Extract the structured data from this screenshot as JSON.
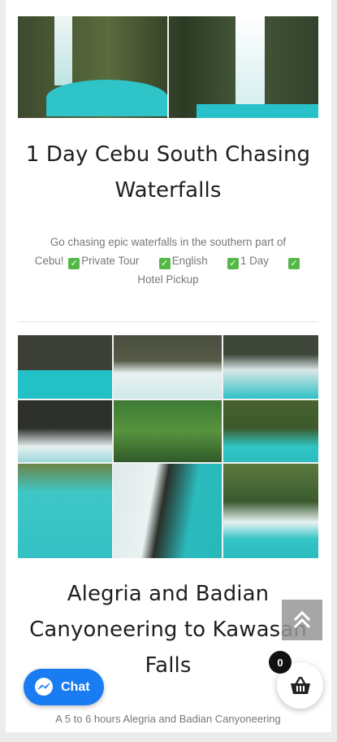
{
  "tours": [
    {
      "title_line1": "1 Day Cebu South Chasing",
      "title_line2": "Waterfalls",
      "desc_line1": "Go chasing epic waterfalls in the southern part of",
      "desc_cebu": "Cebu!",
      "features": [
        "Private Tour",
        "English",
        "1 Day",
        "Hotel Pickup"
      ]
    },
    {
      "title_line1": "Alegria and Badian",
      "title_line2": "Canyoneering to Kawasan",
      "title_line3": "Falls",
      "desc_line1": "A 5 to 6 hours Alegria and Badian Canyoneering"
    }
  ],
  "chat": {
    "label": "Chat",
    "icon": "messenger-icon"
  },
  "cart": {
    "count": "0",
    "icon": "basket-icon"
  },
  "scroll_top": {
    "icon": "double-chevron-up-icon"
  },
  "colors": {
    "chat_blue": "#1a7cf2",
    "check_green": "#53b848",
    "water_turquoise": "#2ec4c8"
  }
}
